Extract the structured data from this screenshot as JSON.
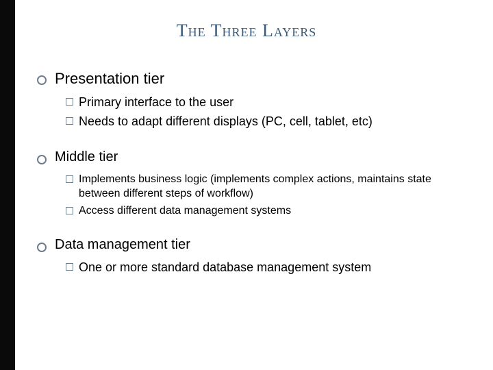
{
  "title": "The Three Layers",
  "sections": [
    {
      "heading": "Presentation tier",
      "heading_size": "lg",
      "item_size": "lg",
      "items": [
        "Primary interface to the user",
        "Needs to adapt different displays (PC, cell, tablet, etc)"
      ]
    },
    {
      "heading": "Middle tier",
      "heading_size": "sm",
      "item_size": "sm",
      "items": [
        "Implements business logic (implements complex actions, maintains state between different steps of workflow)",
        "Access different data management systems"
      ]
    },
    {
      "heading": "Data management tier",
      "heading_size": "sm",
      "item_size": "lg",
      "items": [
        "One or more standard database management system"
      ]
    }
  ]
}
